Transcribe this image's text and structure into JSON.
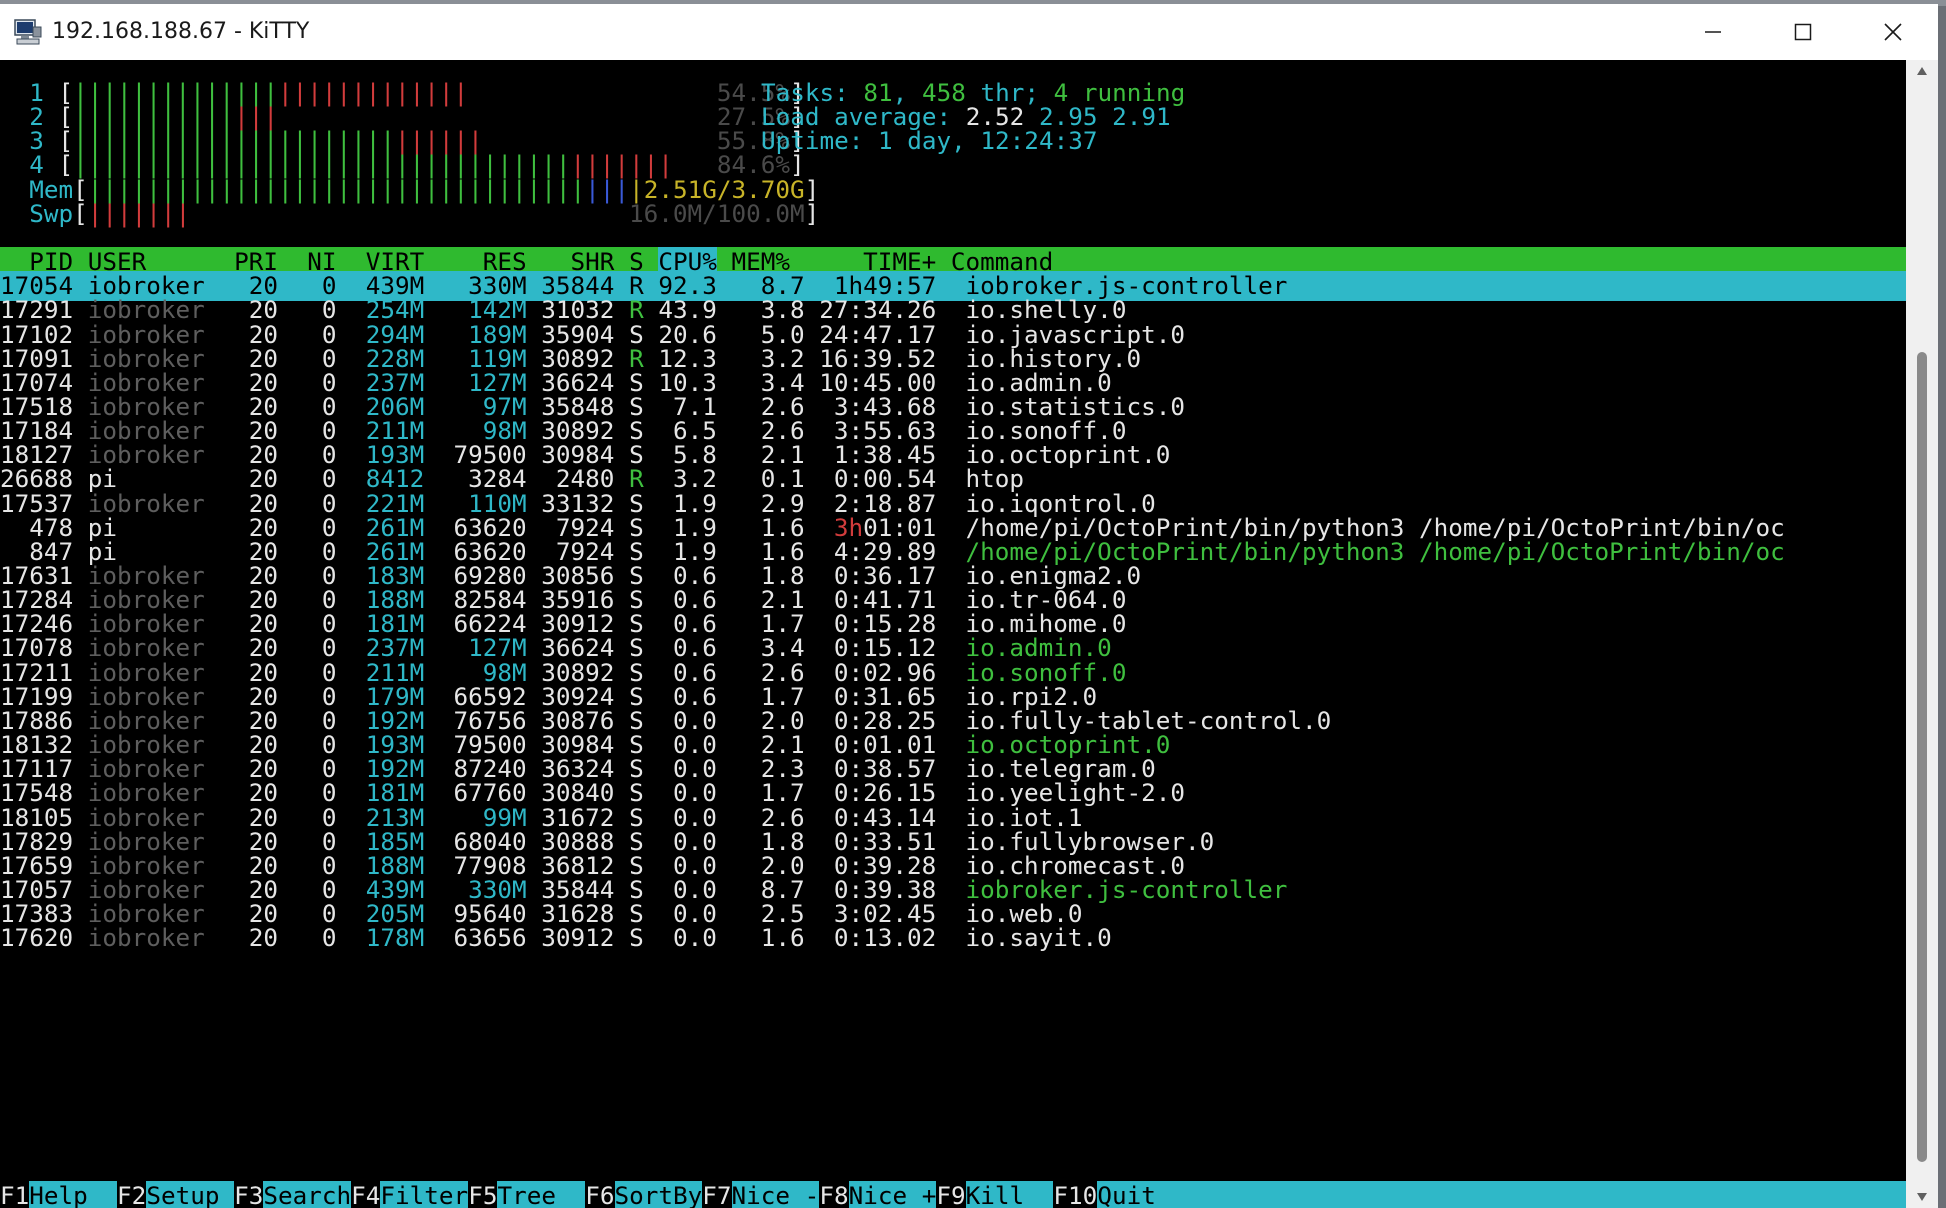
{
  "window": {
    "title": "192.168.188.67 - KiTTY"
  },
  "meters": {
    "cpus": [
      {
        "id": "1",
        "green": 14,
        "red": 13,
        "value": "54.5%"
      },
      {
        "id": "2",
        "green": 11,
        "red": 3,
        "value": "27.5%"
      },
      {
        "id": "3",
        "green": 22,
        "red": 6,
        "value": "55.8%"
      },
      {
        "id": "4",
        "green": 34,
        "red": 7,
        "value": "84.6%"
      }
    ],
    "mem": {
      "label": "Mem",
      "green": 34,
      "blue": 3,
      "value": "2.51G/3.70G"
    },
    "swp": {
      "label": "Swp",
      "red": 7,
      "value": "16.0M/100.0M"
    }
  },
  "summary": {
    "tasks_label": "Tasks: ",
    "tasks": "81",
    "tasks_sep": ", ",
    "threads": "458",
    "threads_label": " thr; ",
    "running": "4",
    "running_label": " running",
    "load_label": "Load average: ",
    "load1": "2.52",
    "load5": "2.95",
    "load15": "2.91",
    "uptime_label": "Uptime: ",
    "uptime": "1 day, 12:24:37"
  },
  "columns": [
    "PID",
    "USER",
    "PRI",
    "NI",
    "VIRT",
    "RES",
    "SHR",
    "S",
    "CPU%",
    "MEM%",
    "TIME+",
    "Command"
  ],
  "processes": [
    {
      "pid": "17054",
      "user": "iobroker",
      "pri": "20",
      "ni": "0",
      "virt": "439M",
      "res": "330M",
      "shr": "35844",
      "s": "R",
      "cpu": "92.3",
      "mem": "8.7",
      "time": "1h49:57",
      "cmd": "iobroker.js-controller"
    },
    {
      "pid": "17291",
      "user": "iobroker",
      "pri": "20",
      "ni": "0",
      "virt": "254M",
      "res": "142M",
      "shr": "31032",
      "s": "R",
      "cpu": "43.9",
      "mem": "3.8",
      "time": "27:34.26",
      "cmd": "io.shelly.0"
    },
    {
      "pid": "17102",
      "user": "iobroker",
      "pri": "20",
      "ni": "0",
      "virt": "294M",
      "res": "189M",
      "shr": "35904",
      "s": "S",
      "cpu": "20.6",
      "mem": "5.0",
      "time": "24:47.17",
      "cmd": "io.javascript.0"
    },
    {
      "pid": "17091",
      "user": "iobroker",
      "pri": "20",
      "ni": "0",
      "virt": "228M",
      "res": "119M",
      "shr": "30892",
      "s": "R",
      "cpu": "12.3",
      "mem": "3.2",
      "time": "16:39.52",
      "cmd": "io.history.0"
    },
    {
      "pid": "17074",
      "user": "iobroker",
      "pri": "20",
      "ni": "0",
      "virt": "237M",
      "res": "127M",
      "shr": "36624",
      "s": "S",
      "cpu": "10.3",
      "mem": "3.4",
      "time": "10:45.00",
      "cmd": "io.admin.0"
    },
    {
      "pid": "17518",
      "user": "iobroker",
      "pri": "20",
      "ni": "0",
      "virt": "206M",
      "res": "97M",
      "shr": "35848",
      "s": "S",
      "cpu": "7.1",
      "mem": "2.6",
      "time": "3:43.68",
      "cmd": "io.statistics.0"
    },
    {
      "pid": "17184",
      "user": "iobroker",
      "pri": "20",
      "ni": "0",
      "virt": "211M",
      "res": "98M",
      "shr": "30892",
      "s": "S",
      "cpu": "6.5",
      "mem": "2.6",
      "time": "3:55.63",
      "cmd": "io.sonoff.0"
    },
    {
      "pid": "18127",
      "user": "iobroker",
      "pri": "20",
      "ni": "0",
      "virt": "193M",
      "res": "79500",
      "shr": "30984",
      "s": "S",
      "cpu": "5.8",
      "mem": "2.1",
      "time": "1:38.45",
      "cmd": "io.octoprint.0"
    },
    {
      "pid": "26688",
      "user": "pi",
      "pri": "20",
      "ni": "0",
      "virt": "8412",
      "res": "3284",
      "shr": "2480",
      "s": "R",
      "cpu": "3.2",
      "mem": "0.1",
      "time": "0:00.54",
      "cmd": "htop"
    },
    {
      "pid": "17537",
      "user": "iobroker",
      "pri": "20",
      "ni": "0",
      "virt": "221M",
      "res": "110M",
      "shr": "33132",
      "s": "S",
      "cpu": "1.9",
      "mem": "2.9",
      "time": "2:18.87",
      "cmd": "io.iqontrol.0"
    },
    {
      "pid": "478",
      "user": "pi",
      "pri": "20",
      "ni": "0",
      "virt": "261M",
      "res": "63620",
      "shr": "7924",
      "s": "S",
      "cpu": "1.9",
      "mem": "1.6",
      "time": "3h01:01",
      "cmd": "/home/pi/OctoPrint/bin/python3 /home/pi/OctoPrint/bin/oc"
    },
    {
      "pid": "847",
      "user": "pi",
      "pri": "20",
      "ni": "0",
      "virt": "261M",
      "res": "63620",
      "shr": "7924",
      "s": "S",
      "cpu": "1.9",
      "mem": "1.6",
      "time": "4:29.89",
      "cmd": "/home/pi/OctoPrint/bin/python3 /home/pi/OctoPrint/bin/oc"
    },
    {
      "pid": "17631",
      "user": "iobroker",
      "pri": "20",
      "ni": "0",
      "virt": "183M",
      "res": "69280",
      "shr": "30856",
      "s": "S",
      "cpu": "0.6",
      "mem": "1.8",
      "time": "0:36.17",
      "cmd": "io.enigma2.0"
    },
    {
      "pid": "17284",
      "user": "iobroker",
      "pri": "20",
      "ni": "0",
      "virt": "188M",
      "res": "82584",
      "shr": "35916",
      "s": "S",
      "cpu": "0.6",
      "mem": "2.1",
      "time": "0:41.71",
      "cmd": "io.tr-064.0"
    },
    {
      "pid": "17246",
      "user": "iobroker",
      "pri": "20",
      "ni": "0",
      "virt": "181M",
      "res": "66224",
      "shr": "30912",
      "s": "S",
      "cpu": "0.6",
      "mem": "1.7",
      "time": "0:15.28",
      "cmd": "io.mihome.0"
    },
    {
      "pid": "17078",
      "user": "iobroker",
      "pri": "20",
      "ni": "0",
      "virt": "237M",
      "res": "127M",
      "shr": "36624",
      "s": "S",
      "cpu": "0.6",
      "mem": "3.4",
      "time": "0:15.12",
      "cmd": "io.admin.0"
    },
    {
      "pid": "17211",
      "user": "iobroker",
      "pri": "20",
      "ni": "0",
      "virt": "211M",
      "res": "98M",
      "shr": "30892",
      "s": "S",
      "cpu": "0.6",
      "mem": "2.6",
      "time": "0:02.96",
      "cmd": "io.sonoff.0"
    },
    {
      "pid": "17199",
      "user": "iobroker",
      "pri": "20",
      "ni": "0",
      "virt": "179M",
      "res": "66592",
      "shr": "30924",
      "s": "S",
      "cpu": "0.6",
      "mem": "1.7",
      "time": "0:31.65",
      "cmd": "io.rpi2.0"
    },
    {
      "pid": "17886",
      "user": "iobroker",
      "pri": "20",
      "ni": "0",
      "virt": "192M",
      "res": "76756",
      "shr": "30876",
      "s": "S",
      "cpu": "0.0",
      "mem": "2.0",
      "time": "0:28.25",
      "cmd": "io.fully-tablet-control.0"
    },
    {
      "pid": "18132",
      "user": "iobroker",
      "pri": "20",
      "ni": "0",
      "virt": "193M",
      "res": "79500",
      "shr": "30984",
      "s": "S",
      "cpu": "0.0",
      "mem": "2.1",
      "time": "0:01.01",
      "cmd": "io.octoprint.0"
    },
    {
      "pid": "17117",
      "user": "iobroker",
      "pri": "20",
      "ni": "0",
      "virt": "192M",
      "res": "87240",
      "shr": "36324",
      "s": "S",
      "cpu": "0.0",
      "mem": "2.3",
      "time": "0:38.57",
      "cmd": "io.telegram.0"
    },
    {
      "pid": "17548",
      "user": "iobroker",
      "pri": "20",
      "ni": "0",
      "virt": "181M",
      "res": "67760",
      "shr": "30840",
      "s": "S",
      "cpu": "0.0",
      "mem": "1.7",
      "time": "0:26.15",
      "cmd": "io.yeelight-2.0"
    },
    {
      "pid": "18105",
      "user": "iobroker",
      "pri": "20",
      "ni": "0",
      "virt": "213M",
      "res": "99M",
      "shr": "31672",
      "s": "S",
      "cpu": "0.0",
      "mem": "2.6",
      "time": "0:43.14",
      "cmd": "io.iot.1"
    },
    {
      "pid": "17829",
      "user": "iobroker",
      "pri": "20",
      "ni": "0",
      "virt": "185M",
      "res": "68040",
      "shr": "30888",
      "s": "S",
      "cpu": "0.0",
      "mem": "1.8",
      "time": "0:33.51",
      "cmd": "io.fullybrowser.0"
    },
    {
      "pid": "17659",
      "user": "iobroker",
      "pri": "20",
      "ni": "0",
      "virt": "188M",
      "res": "77908",
      "shr": "36812",
      "s": "S",
      "cpu": "0.0",
      "mem": "2.0",
      "time": "0:39.28",
      "cmd": "io.chromecast.0"
    },
    {
      "pid": "17057",
      "user": "iobroker",
      "pri": "20",
      "ni": "0",
      "virt": "439M",
      "res": "330M",
      "shr": "35844",
      "s": "S",
      "cpu": "0.0",
      "mem": "8.7",
      "time": "0:39.38",
      "cmd": "iobroker.js-controller"
    },
    {
      "pid": "17383",
      "user": "iobroker",
      "pri": "20",
      "ni": "0",
      "virt": "205M",
      "res": "95640",
      "shr": "31628",
      "s": "S",
      "cpu": "0.0",
      "mem": "2.5",
      "time": "3:02.45",
      "cmd": "io.web.0"
    },
    {
      "pid": "17620",
      "user": "iobroker",
      "pri": "20",
      "ni": "0",
      "virt": "178M",
      "res": "63656",
      "shr": "30912",
      "s": "S",
      "cpu": "0.0",
      "mem": "1.6",
      "time": "0:13.02",
      "cmd": "io.sayit.0"
    }
  ],
  "function_keys": [
    {
      "key": "F1",
      "label": "Help  "
    },
    {
      "key": "F2",
      "label": "Setup "
    },
    {
      "key": "F3",
      "label": "Search"
    },
    {
      "key": "F4",
      "label": "Filter"
    },
    {
      "key": "F5",
      "label": "Tree  "
    },
    {
      "key": "F6",
      "label": "SortBy"
    },
    {
      "key": "F7",
      "label": "Nice -"
    },
    {
      "key": "F8",
      "label": "Nice +"
    },
    {
      "key": "F9",
      "label": "Kill  "
    },
    {
      "key": "F10",
      "label": "Quit"
    }
  ],
  "colors": {
    "terminal_bg": "#000000",
    "cyan": "#2fb8c8",
    "green": "#3fbf3f",
    "red": "#d23c3c",
    "header_green": "#2fba2f"
  }
}
